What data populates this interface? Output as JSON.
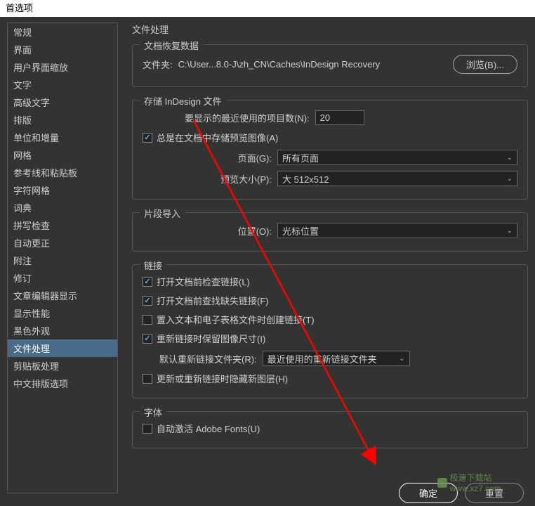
{
  "dialog_title": "首选项",
  "sidebar": {
    "items": [
      "常规",
      "界面",
      "用户界面缩放",
      "文字",
      "高级文字",
      "排版",
      "单位和增量",
      "网格",
      "参考线和粘贴板",
      "字符网格",
      "词典",
      "拼写检查",
      "自动更正",
      "附注",
      "修订",
      "文章编辑器显示",
      "显示性能",
      "黑色外观",
      "文件处理",
      "剪贴板处理",
      "中文排版选项"
    ],
    "active_index": 18
  },
  "page_title": "文件处理",
  "recovery": {
    "section_title": "文档恢复数据",
    "folder_label": "文件夹:",
    "folder_path": "C:\\User...8.0-J\\zh_CN\\Caches\\InDesign Recovery",
    "browse_label": "浏览(B)..."
  },
  "save": {
    "section_title": "存储 InDesign 文件",
    "recent_label": "要显示的最近使用的项目数(N):",
    "recent_value": "20",
    "always_save_checked": true,
    "always_save_label": "总是在文档中存储预览图像(A)",
    "page_label": "页面(G):",
    "page_value": "所有页面",
    "preview_label": "预览大小(P):",
    "preview_value": "大 512x512"
  },
  "snippet": {
    "section_title": "片段导入",
    "position_label": "位置(O):",
    "position_value": "光标位置"
  },
  "links": {
    "section_title": "链接",
    "check_links_checked": true,
    "check_links_label": "打开文档前检查链接(L)",
    "find_missing_checked": true,
    "find_missing_label": "打开文档前查找缺失链接(F)",
    "create_links_checked": false,
    "create_links_label": "置入文本和电子表格文件时创建链接(T)",
    "preserve_dim_checked": true,
    "preserve_dim_label": "重新链接时保留图像尺寸(I)",
    "relink_folder_label": "默认重新链接文件夹(R):",
    "relink_folder_value": "最近使用的重新链接文件夹",
    "hide_layers_checked": false,
    "hide_layers_label": "更新或重新链接时隐藏新图层(H)"
  },
  "fonts": {
    "section_title": "字体",
    "auto_activate_checked": false,
    "auto_activate_label": "自动激活 Adobe Fonts(U)"
  },
  "footer": {
    "ok": "确定",
    "reset": "重置"
  },
  "watermark": {
    "text1": "极速下载站",
    "text2": "www.xz7.com"
  }
}
